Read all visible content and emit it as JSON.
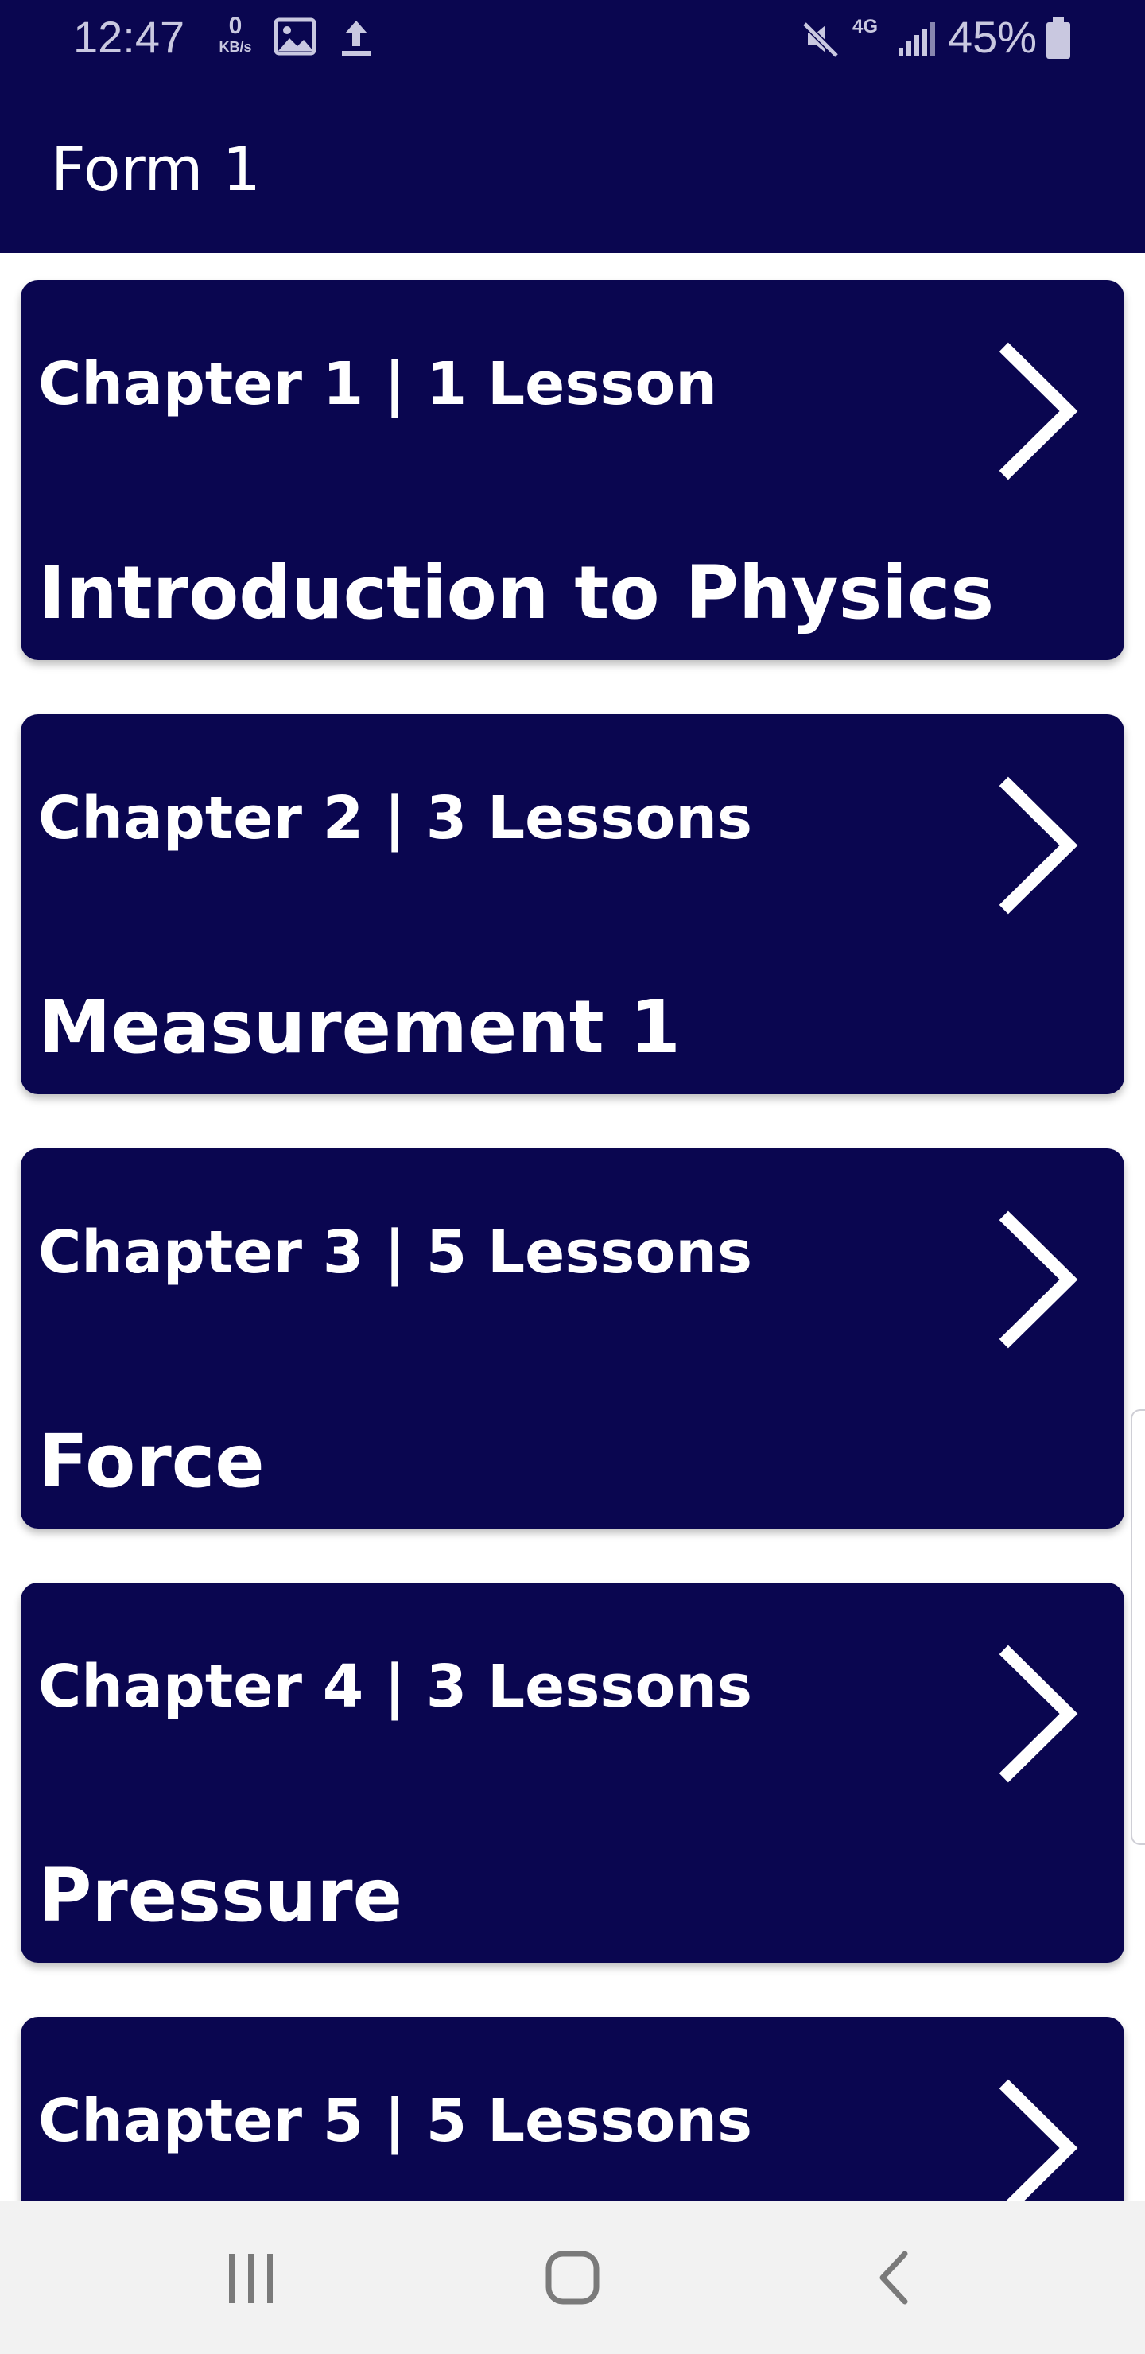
{
  "status_bar": {
    "time": "12:47",
    "net_speed_value": "0",
    "net_speed_unit": "KB/s",
    "network_type": "4G",
    "battery": "45%",
    "icons": [
      "image-icon",
      "upload-icon",
      "mute-icon",
      "signal-icon",
      "battery-icon"
    ]
  },
  "app_bar": {
    "title": "Form 1"
  },
  "chapters": [
    {
      "meta": "Chapter 1 | 1 Lesson",
      "title": "Introduction to Physics"
    },
    {
      "meta": "Chapter 2 | 3 Lessons",
      "title": "Measurement 1"
    },
    {
      "meta": "Chapter 3 | 5 Lessons",
      "title": "Force"
    },
    {
      "meta": "Chapter 4 | 3 Lessons",
      "title": "Pressure"
    },
    {
      "meta": "Chapter 5 | 5 Lessons",
      "title": ""
    }
  ],
  "nav_bar": {
    "icons": [
      "recent-apps-icon",
      "home-icon",
      "back-icon"
    ]
  },
  "colors": {
    "primary": "#0a0650",
    "on_primary": "#ffffff",
    "nav_background": "#f2f2f2",
    "nav_icon": "#7a7a7a"
  }
}
